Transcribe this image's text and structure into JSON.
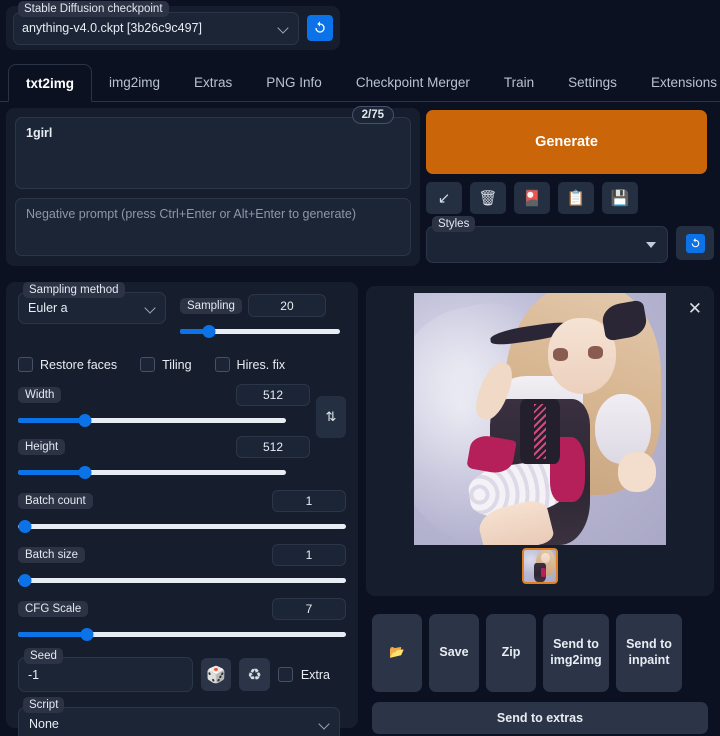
{
  "checkpoint": {
    "legend": "Stable Diffusion checkpoint",
    "value": "anything-v4.0.ckpt [3b26c9c497]",
    "refresh_icon": "refresh-icon"
  },
  "tabs": [
    {
      "label": "txt2img",
      "active": true
    },
    {
      "label": "img2img",
      "active": false
    },
    {
      "label": "Extras",
      "active": false
    },
    {
      "label": "PNG Info",
      "active": false
    },
    {
      "label": "Checkpoint Merger",
      "active": false
    },
    {
      "label": "Train",
      "active": false
    },
    {
      "label": "Settings",
      "active": false
    },
    {
      "label": "Extensions",
      "active": false
    }
  ],
  "prompt": {
    "value": "1girl",
    "token_counter": "2/75",
    "negative_placeholder": "Negative prompt (press Ctrl+Enter or Alt+Enter to generate)"
  },
  "generate": {
    "label": "Generate",
    "color": "#cb650a"
  },
  "toolbar": [
    {
      "name": "restore-progress-icon",
      "glyph": "↙"
    },
    {
      "name": "clear-prompt-icon",
      "glyph": "🗑"
    },
    {
      "name": "apply-style-icon",
      "glyph": "🎴"
    },
    {
      "name": "paste-icon",
      "glyph": "📋"
    },
    {
      "name": "save-style-icon",
      "glyph": "💾"
    }
  ],
  "styles": {
    "legend": "Styles",
    "value": "",
    "refresh_icon": "refresh-icon"
  },
  "settings": {
    "sampling_method": {
      "legend": "Sampling method",
      "value": "Euler a"
    },
    "sampling_steps": {
      "legend": "Sampling",
      "value": "20",
      "percent": 18
    },
    "checkboxes": [
      {
        "label": "Restore faces",
        "checked": false
      },
      {
        "label": "Tiling",
        "checked": false
      },
      {
        "label": "Hires. fix",
        "checked": false
      }
    ],
    "width": {
      "label": "Width",
      "value": "512",
      "percent": 25
    },
    "height": {
      "label": "Height",
      "value": "512",
      "percent": 25
    },
    "swap_icon": "swap-dimensions-icon",
    "batch_count": {
      "label": "Batch count",
      "value": "1",
      "percent": 0
    },
    "batch_size": {
      "label": "Batch size",
      "value": "1",
      "percent": 0
    },
    "cfg_scale": {
      "label": "CFG Scale",
      "value": "7",
      "percent": 21
    },
    "seed": {
      "legend": "Seed",
      "value": "-1"
    },
    "seed_random_icon": "dice-icon",
    "seed_recycle_icon": "recycle-icon",
    "extra_checkbox": {
      "label": "Extra",
      "checked": false
    },
    "script": {
      "legend": "Script",
      "value": "None"
    }
  },
  "result": {
    "close_icon": "close-icon",
    "thumbnail_selected_color": "#e08020"
  },
  "actions": [
    {
      "name": "open-folder-button",
      "label": "📂",
      "wide": false
    },
    {
      "name": "save-button",
      "label": "Save",
      "wide": false
    },
    {
      "name": "zip-button",
      "label": "Zip",
      "wide": false
    },
    {
      "name": "send-to-img2img-button",
      "label": "Send to img2img",
      "wide": true
    },
    {
      "name": "send-to-inpaint-button",
      "label": "Send to inpaint",
      "wide": true
    }
  ],
  "send_to_extras": {
    "label": "Send to extras"
  }
}
